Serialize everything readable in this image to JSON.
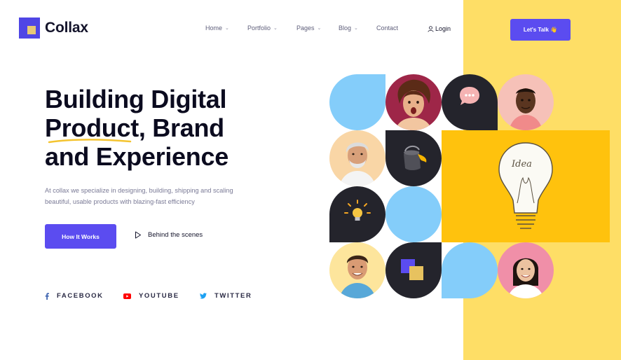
{
  "brand": {
    "name": "Collax"
  },
  "nav": {
    "items": [
      {
        "label": "Home",
        "has_dropdown": true
      },
      {
        "label": "Portfolio",
        "has_dropdown": true
      },
      {
        "label": "Pages",
        "has_dropdown": true
      },
      {
        "label": "Blog",
        "has_dropdown": true
      },
      {
        "label": "Contact",
        "has_dropdown": false
      }
    ],
    "login_label": "Login",
    "cta_label": "Let's Talk 👋"
  },
  "hero": {
    "title_line1": "Building Digital",
    "title_word_underlined": "Product",
    "title_line2_rest": ", Brand",
    "title_line3": "and Experience",
    "description": "At collax we specialize in designing, building, shipping and scaling beautiful, usable products with blazing-fast efficiency",
    "primary_button": "How It Works",
    "secondary_button": "Behind the scenes"
  },
  "socials": [
    {
      "label": "FACEBOOK",
      "icon": "facebook-icon"
    },
    {
      "label": "YOUTUBE",
      "icon": "youtube-icon"
    },
    {
      "label": "TWITTER",
      "icon": "twitter-icon"
    }
  ],
  "colors": {
    "accent": "#5b4cf0",
    "yellow_panel": "#fede66",
    "tile_blue": "#84cdfa",
    "tile_dark": "#24242c",
    "tile_yellow": "#ffc20d"
  }
}
